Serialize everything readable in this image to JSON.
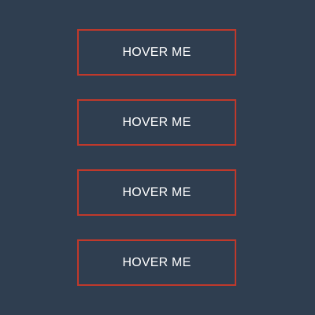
{
  "theme": {
    "background": "#2f3e50",
    "accent": "#c0392b",
    "text": "#ffffff"
  },
  "buttons": [
    {
      "label": "HOVER ME"
    },
    {
      "label": "HOVER ME"
    },
    {
      "label": "HOVER ME"
    },
    {
      "label": "HOVER ME"
    }
  ]
}
